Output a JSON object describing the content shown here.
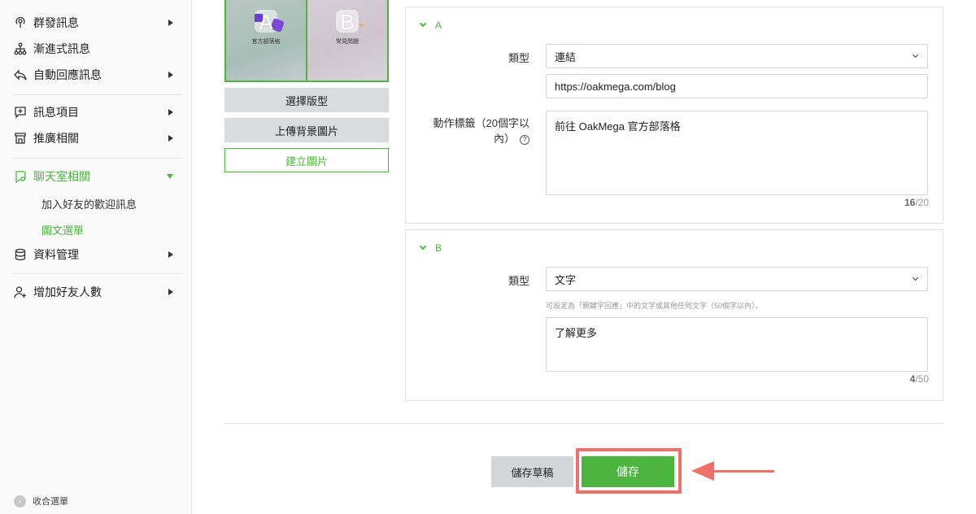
{
  "sidebar": {
    "items": [
      {
        "label": "群發訊息",
        "icon": "broadcast-icon"
      },
      {
        "label": "漸進式訊息",
        "icon": "hierarchy-icon"
      },
      {
        "label": "自動回應訊息",
        "icon": "reply-icon"
      },
      {
        "label": "訊息項目",
        "icon": "message-add-icon"
      },
      {
        "label": "推廣相關",
        "icon": "store-icon"
      },
      {
        "label": "聊天室相關",
        "icon": "chat-icon"
      },
      {
        "label": "資料管理",
        "icon": "database-icon"
      },
      {
        "label": "增加好友人數",
        "icon": "add-friend-icon"
      }
    ],
    "subitems": [
      {
        "label": "加入好友的歡迎訊息"
      },
      {
        "label": "圖文選單"
      }
    ],
    "collapse_label": "收合選單",
    "accent": "#4cb53f"
  },
  "preview": {
    "tile_a": {
      "letter": "A",
      "caption": "官方部落格"
    },
    "tile_b": {
      "letter": "B",
      "caption": "常見問題"
    }
  },
  "buttons": {
    "choose_template": "選擇版型",
    "upload_bg": "上傳背景圖片",
    "create_image": "建立圖片",
    "save_draft": "儲存草稿",
    "save": "儲存"
  },
  "section_a": {
    "title": "A",
    "type_label": "類型",
    "type_value": "連結",
    "url_value": "https://oakmega.com/blog",
    "action_label": "動作標籤（20個字以內）",
    "action_label_line1": "動作標籤（20個字以",
    "action_label_line2": "內）",
    "help_glyph": "?",
    "action_value": "前往 OakMega 官方部落格",
    "count": "16",
    "max": "/20"
  },
  "section_b": {
    "title": "B",
    "type_label": "類型",
    "type_value": "文字",
    "hint": "可設定為「關鍵字回應」中的文字或其他任何文字（50個字以內）。",
    "text_value": "了解更多",
    "count": "4",
    "max": "/50"
  }
}
